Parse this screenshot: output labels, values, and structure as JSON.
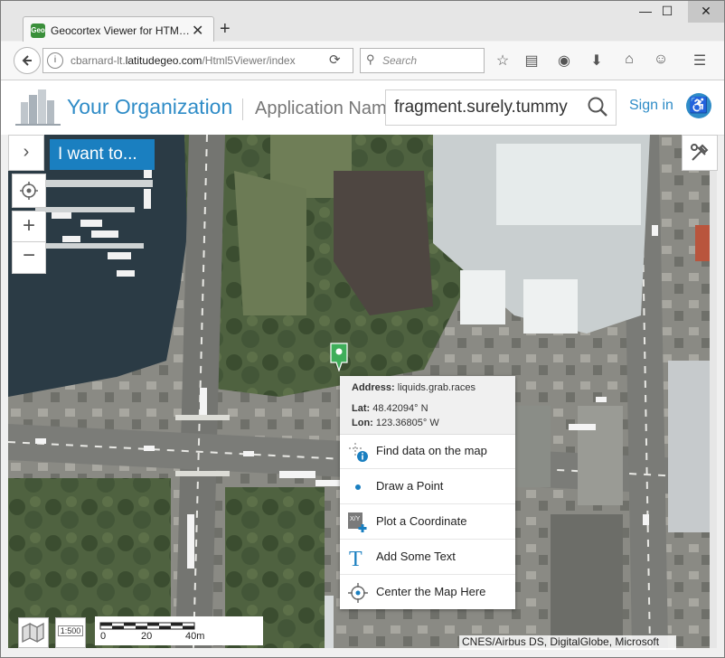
{
  "browser": {
    "tab_title": "Geocortex Viewer for HTM…",
    "tab_icon_text": "Geo",
    "url_prefix": "cbarnard-lt.",
    "url_domain": "latitudegeo.com",
    "url_path": "/Html5Viewer/index",
    "search_placeholder": "Search",
    "window_controls": {
      "minimize": "—",
      "maximize": "☐",
      "close": "✕"
    }
  },
  "app": {
    "organization": "Your Organization",
    "application_name": "Application Name",
    "search_value": "fragment.surely.tummy",
    "sign_in": "Sign in",
    "i_want_to": "I want to...",
    "accent_color": "#1a7fc0"
  },
  "popup": {
    "address_label": "Address:",
    "address_value": "liquids.grab.races",
    "lat_label": "Lat:",
    "lat_value": "48.42094° N",
    "lon_label": "Lon:",
    "lon_value": "123.36805° W",
    "items": [
      {
        "label": "Find data on the map",
        "icon": "find-data-icon"
      },
      {
        "label": "Draw a Point",
        "icon": "draw-point-icon"
      },
      {
        "label": "Plot a Coordinate",
        "icon": "plot-coordinate-icon"
      },
      {
        "label": "Add Some Text",
        "icon": "add-text-icon"
      },
      {
        "label": "Center the Map Here",
        "icon": "center-map-icon"
      }
    ]
  },
  "map": {
    "scale_ticks": [
      "0",
      "20",
      "40m"
    ],
    "scale_button": "1:500",
    "attribution": "CNES/Airbus DS, DigitalGlobe, Microsoft"
  }
}
